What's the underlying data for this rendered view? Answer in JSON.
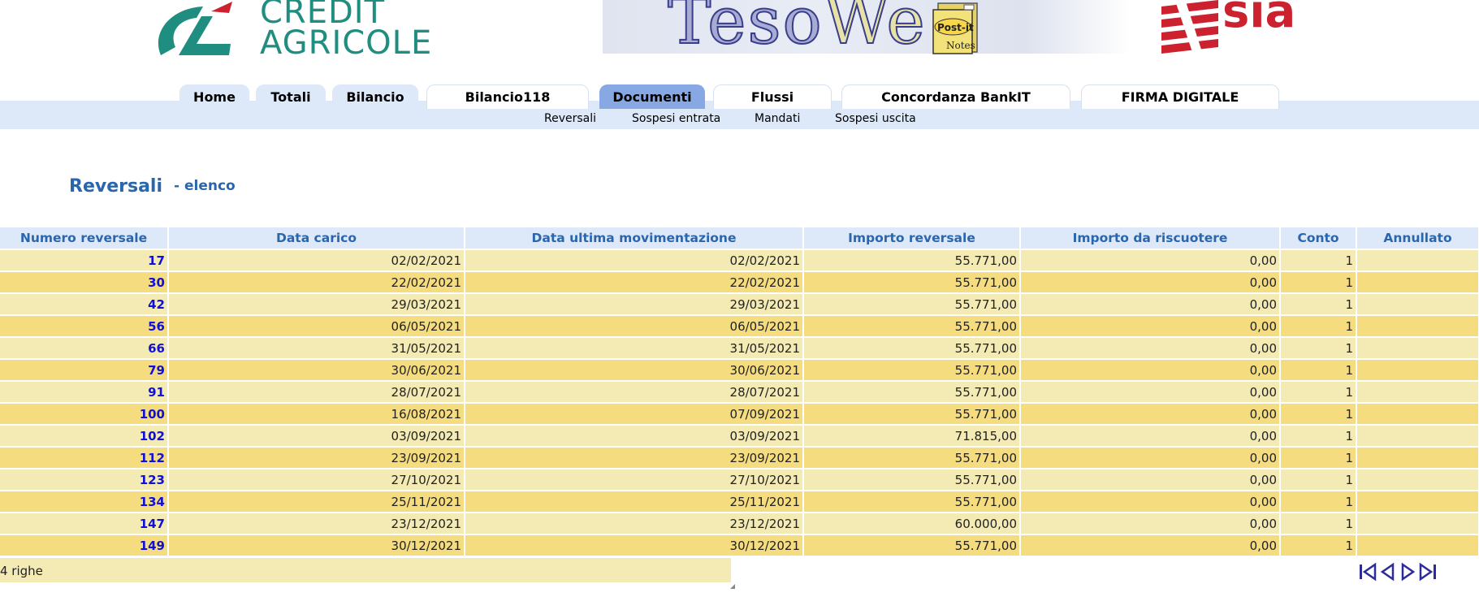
{
  "banner": {
    "credit_agricole": [
      "CREDIT",
      "AGRICOLE"
    ],
    "tesoweb": {
      "teso": "Teso",
      "web": "We"
    },
    "postit": {
      "label": "Post-it",
      "notes": "Notes"
    },
    "sia": "sia"
  },
  "colors": {
    "accent": "#2a66ad",
    "nav_strip": "#dde8f8",
    "active_tab": "#87a8e3",
    "row_light": "#f3eab4",
    "row_dark": "#f5dc7e",
    "link": "#1010d8"
  },
  "nav": {
    "tabs": [
      {
        "label": "Home"
      },
      {
        "label": "Totali"
      },
      {
        "label": "Bilancio"
      },
      {
        "label": "Bilancio118"
      },
      {
        "label": "Documenti",
        "active": true
      },
      {
        "label": "Flussi"
      },
      {
        "label": "Concordanza BankIT"
      },
      {
        "label": "FIRMA DIGITALE"
      }
    ],
    "subnav": [
      {
        "label": "Reversali"
      },
      {
        "label": "Sospesi entrata"
      },
      {
        "label": "Mandati"
      },
      {
        "label": "Sospesi uscita"
      }
    ]
  },
  "page": {
    "title": "Reversali",
    "subtitle": "- elenco"
  },
  "table": {
    "headers": [
      "Numero reversale",
      "Data carico",
      "Data ultima movimentazione",
      "Importo reversale",
      "Importo da riscuotere",
      "Conto",
      "Annullato"
    ],
    "rows": [
      [
        "17",
        "02/02/2021",
        "02/02/2021",
        "55.771,00",
        "0,00",
        "1",
        ""
      ],
      [
        "30",
        "22/02/2021",
        "22/02/2021",
        "55.771,00",
        "0,00",
        "1",
        ""
      ],
      [
        "42",
        "29/03/2021",
        "29/03/2021",
        "55.771,00",
        "0,00",
        "1",
        ""
      ],
      [
        "56",
        "06/05/2021",
        "06/05/2021",
        "55.771,00",
        "0,00",
        "1",
        ""
      ],
      [
        "66",
        "31/05/2021",
        "31/05/2021",
        "55.771,00",
        "0,00",
        "1",
        ""
      ],
      [
        "79",
        "30/06/2021",
        "30/06/2021",
        "55.771,00",
        "0,00",
        "1",
        ""
      ],
      [
        "91",
        "28/07/2021",
        "28/07/2021",
        "55.771,00",
        "0,00",
        "1",
        ""
      ],
      [
        "100",
        "16/08/2021",
        "07/09/2021",
        "55.771,00",
        "0,00",
        "1",
        ""
      ],
      [
        "102",
        "03/09/2021",
        "03/09/2021",
        "71.815,00",
        "0,00",
        "1",
        ""
      ],
      [
        "112",
        "23/09/2021",
        "23/09/2021",
        "55.771,00",
        "0,00",
        "1",
        ""
      ],
      [
        "123",
        "27/10/2021",
        "27/10/2021",
        "55.771,00",
        "0,00",
        "1",
        ""
      ],
      [
        "134",
        "25/11/2021",
        "25/11/2021",
        "55.771,00",
        "0,00",
        "1",
        ""
      ],
      [
        "147",
        "23/12/2021",
        "23/12/2021",
        "60.000,00",
        "0,00",
        "1",
        ""
      ],
      [
        "149",
        "30/12/2021",
        "30/12/2021",
        "55.771,00",
        "0,00",
        "1",
        ""
      ]
    ]
  },
  "footer": {
    "row_count": "4 righe",
    "pager_icons": [
      "first-page-icon",
      "previous-page-icon",
      "next-page-icon",
      "last-page-icon"
    ]
  }
}
